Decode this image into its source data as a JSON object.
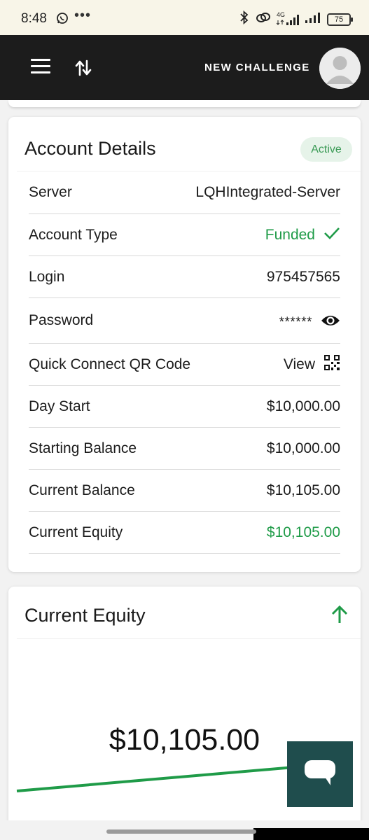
{
  "status_bar": {
    "time": "8:48",
    "dots": "•••",
    "network": "4G",
    "battery": "75"
  },
  "app_bar": {
    "new_challenge_label": "NEW CHALLENGE"
  },
  "account_details": {
    "title": "Account Details",
    "status": "Active",
    "rows": [
      {
        "label": "Server",
        "value": "LQHIntegrated-Server"
      },
      {
        "label": "Account Type",
        "value": "Funded"
      },
      {
        "label": "Login",
        "value": "975457565"
      },
      {
        "label": "Password",
        "value": "******"
      },
      {
        "label": "Quick Connect QR Code",
        "value": "View"
      },
      {
        "label": "Day Start",
        "value": "$10,000.00"
      },
      {
        "label": "Starting Balance",
        "value": "$10,000.00"
      },
      {
        "label": "Current Balance",
        "value": "$10,105.00"
      },
      {
        "label": "Current Equity",
        "value": "$10,105.00"
      }
    ]
  },
  "current_equity": {
    "title": "Current Equity",
    "value": "$10,105.00",
    "trend": "up"
  },
  "colors": {
    "appbar_bg": "#1c1c1c",
    "accent_green": "#1f9b48",
    "badge_bg": "#e6f3e9",
    "chat_fab_bg": "#1f4d4d",
    "status_bar_bg": "#f8f5e8"
  },
  "icons": {
    "menu": "hamburger-menu-icon",
    "swap": "swap-arrows-icon",
    "avatar": "user-avatar-icon",
    "check": "check-icon",
    "eye": "eye-icon",
    "qr": "qr-code-icon",
    "trend": "arrow-up-icon",
    "chat": "chat-bubble-icon"
  }
}
